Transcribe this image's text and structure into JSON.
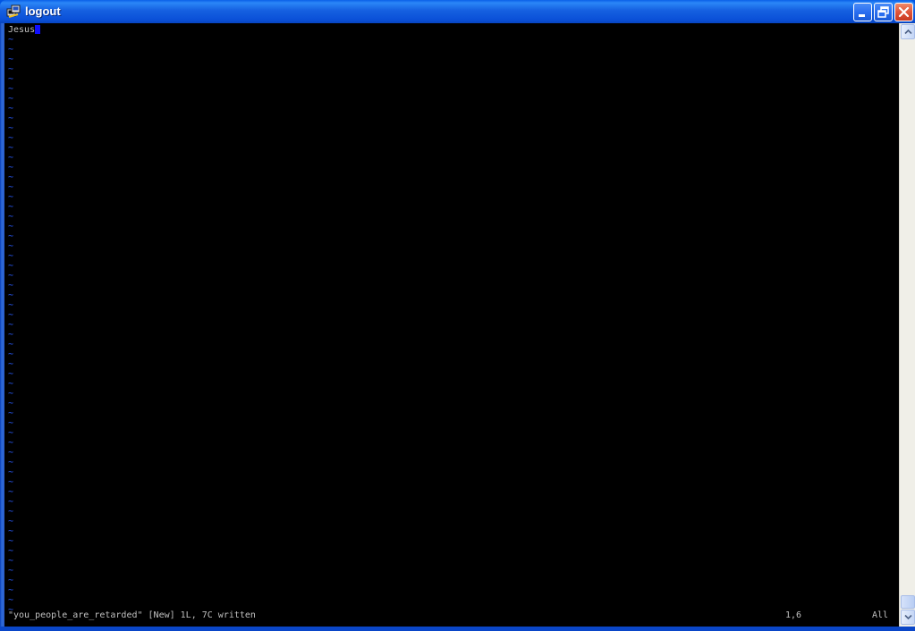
{
  "window": {
    "title": "logout",
    "title_icon": "putty-terminal-icon",
    "controls": [
      "minimize",
      "restore",
      "close"
    ]
  },
  "editor": {
    "lines": [
      {
        "text": "Jesus"
      }
    ],
    "empty_line_marker": "~",
    "cursor_color": "#1010ff",
    "tilde_color": "#2a5cff"
  },
  "status": {
    "message": "\"you_people_are_retarded\" [New] 1L, 7C written",
    "position": "1,6",
    "scroll": "All"
  },
  "colors": {
    "titlebar": "#0a50d8",
    "background": "#000000",
    "text": "#c0c0c0"
  }
}
